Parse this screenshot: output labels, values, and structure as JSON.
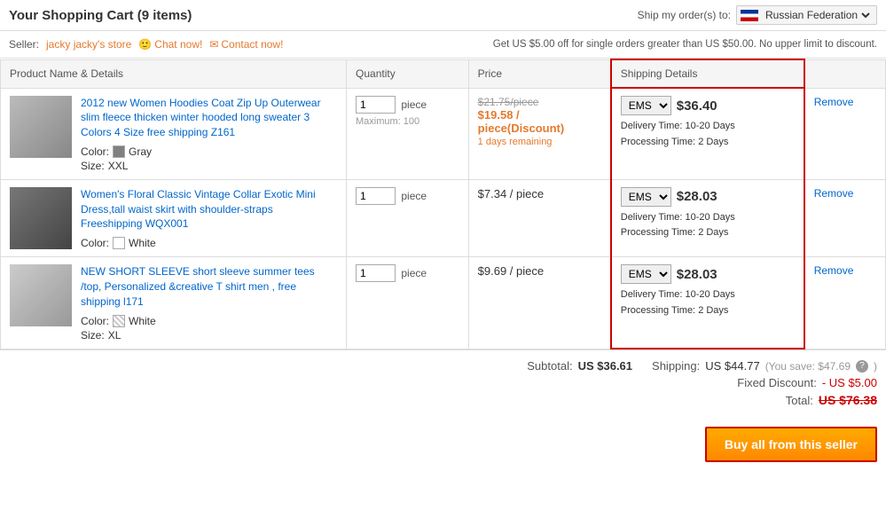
{
  "page": {
    "title": "Your Shopping Cart (9 items)"
  },
  "ship_to": {
    "label": "Ship my order(s) to:",
    "country": "Russian Federation"
  },
  "seller": {
    "label": "Seller:",
    "name": "jacky jacky's store",
    "chat_label": "Chat now!",
    "contact_label": "Contact now!",
    "promo": "Get US $5.00 off for single orders greater than US $50.00. No upper limit to discount."
  },
  "table_headers": {
    "product": "Product Name & Details",
    "quantity": "Quantity",
    "price": "Price",
    "shipping": "Shipping Details",
    "action": ""
  },
  "items": [
    {
      "id": 1,
      "title": "2012 new Women Hoodies Coat Zip Up Outerwear slim fleece thicken winter hooded long sweater 3 Colors 4 Size free shipping Z161",
      "color_label": "Color:",
      "color": "Gray",
      "size_label": "Size:",
      "size": "XXL",
      "quantity": "1",
      "quantity_unit": "piece",
      "quantity_max": "Maximum: 100",
      "price_original": "$21.75/piece",
      "price_discount": "$19.58 / piece(Discount)",
      "price_days": "1 days remaining",
      "shipping_method": "EMS",
      "shipping_price": "$36.40",
      "delivery_time": "10-20 Days",
      "processing_time": "2 Days",
      "action": "Remove"
    },
    {
      "id": 2,
      "title": "Women's Floral Classic Vintage Collar Exotic Mini Dress,tall waist skirt with shoulder-straps Freeshipping WQX001",
      "color_label": "Color:",
      "color": "White",
      "size_label": null,
      "size": null,
      "quantity": "1",
      "quantity_unit": "piece",
      "quantity_max": null,
      "price_original": null,
      "price_discount": null,
      "price_regular": "$7.34 / piece",
      "shipping_method": "EMS",
      "shipping_price": "$28.03",
      "delivery_time": "10-20 Days",
      "processing_time": "2 Days",
      "action": "Remove"
    },
    {
      "id": 3,
      "title": "NEW SHORT SLEEVE short sleeve summer tees /top, Personalized &creative T shirt men , free shipping l171",
      "color_label": "Color:",
      "color": "White",
      "size_label": "Size:",
      "size": "XL",
      "quantity": "1",
      "quantity_unit": "piece",
      "quantity_max": null,
      "price_original": null,
      "price_discount": null,
      "price_regular": "$9.69 / piece",
      "shipping_method": "EMS",
      "shipping_price": "$28.03",
      "delivery_time": "10-20 Days",
      "processing_time": "2 Days",
      "action": "Remove"
    }
  ],
  "summary": {
    "subtotal_label": "Subtotal:",
    "subtotal_value": "US $36.61",
    "shipping_label": "Shipping:",
    "shipping_value": "US $44.77",
    "save_label": "(You save: $47.69",
    "save_suffix": ")",
    "fixed_discount_label": "Fixed Discount:",
    "fixed_discount_value": "- US $5.00",
    "total_label": "Total:",
    "total_value": "US $76.38",
    "buy_button": "Buy all from this seller"
  },
  "delivery_label": "Delivery Time:",
  "processing_label": "Processing Time:"
}
